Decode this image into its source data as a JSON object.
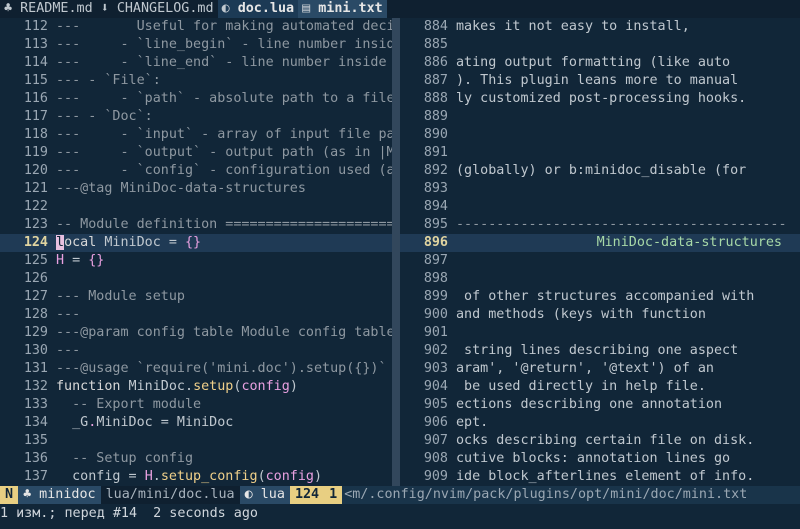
{
  "tabs": [
    {
      "icon": "file-icon",
      "glyph": "♣",
      "label": "README.md",
      "state": "normal"
    },
    {
      "icon": "markdown-icon",
      "glyph": "⬇",
      "label": "CHANGELOG.md",
      "state": "normal"
    },
    {
      "icon": "lua-icon",
      "glyph": "◐",
      "label": "doc.lua",
      "state": "active"
    },
    {
      "icon": "text-icon",
      "glyph": "▤",
      "label": "mini.txt",
      "state": "visible"
    }
  ],
  "left_pane": {
    "lines": [
      {
        "n": "112",
        "text": "---       Useful for making automated deci"
      },
      {
        "n": "113",
        "text": "---     - `line_begin` - line number insid"
      },
      {
        "n": "114",
        "text": "---     - `line_end` - line number inside"
      },
      {
        "n": "115",
        "text": "--- - `File`:"
      },
      {
        "n": "116",
        "text": "---     - `path` - absolute path to a file"
      },
      {
        "n": "117",
        "text": "--- - `Doc`:"
      },
      {
        "n": "118",
        "text": "---     - `input` - array of input file pa"
      },
      {
        "n": "119",
        "text": "---     - `output` - output path (as in |M"
      },
      {
        "n": "120",
        "text": "---     - `config` - configuration used (a"
      },
      {
        "n": "121",
        "text": "---@tag MiniDoc-data-structures"
      },
      {
        "n": "122",
        "text": ""
      },
      {
        "n": "123",
        "text": "-- Module definition ====================="
      },
      {
        "n": "124",
        "text": "local MiniDoc = {}"
      },
      {
        "n": "125",
        "text": "H = {}"
      },
      {
        "n": "126",
        "text": ""
      },
      {
        "n": "127",
        "text": "--- Module setup"
      },
      {
        "n": "128",
        "text": "---"
      },
      {
        "n": "129",
        "text": "---@param config table Module config table"
      },
      {
        "n": "130",
        "text": "---"
      },
      {
        "n": "131",
        "text": "---@usage `require('mini.doc').setup({})`"
      },
      {
        "n": "132",
        "text": "function MiniDoc.setup(config)"
      },
      {
        "n": "133",
        "text": "  -- Export module"
      },
      {
        "n": "134",
        "text": "  _G.MiniDoc = MiniDoc"
      },
      {
        "n": "135",
        "text": ""
      },
      {
        "n": "136",
        "text": "  -- Setup config"
      },
      {
        "n": "137",
        "text": "  config = H.setup_config(config)"
      }
    ],
    "current_line": "124"
  },
  "right_pane": {
    "lines": [
      {
        "n": "884",
        "text": "makes it not easy to install,"
      },
      {
        "n": "885",
        "text": ""
      },
      {
        "n": "886",
        "text": "ating output formatting (like auto"
      },
      {
        "n": "887",
        "text": "). This plugin leans more to manual"
      },
      {
        "n": "888",
        "text": "ly customized post-processing hooks."
      },
      {
        "n": "889",
        "text": ""
      },
      {
        "n": "890",
        "text": ""
      },
      {
        "n": "891",
        "text": ""
      },
      {
        "n": "892",
        "text": "(globally) or b:minidoc_disable (for"
      },
      {
        "n": "893",
        "text": ""
      },
      {
        "n": "894",
        "text": ""
      },
      {
        "n": "895",
        "text": "-----------------------------------------"
      },
      {
        "n": "896",
        "text": "MiniDoc-data-structures"
      },
      {
        "n": "897",
        "text": ""
      },
      {
        "n": "898",
        "text": ""
      },
      {
        "n": "899",
        "text": " of other structures accompanied with"
      },
      {
        "n": "900",
        "text": "and methods (keys with function"
      },
      {
        "n": "901",
        "text": ""
      },
      {
        "n": "902",
        "text": " string lines describing one aspect"
      },
      {
        "n": "903",
        "text": "aram', '@return', '@text') of an"
      },
      {
        "n": "904",
        "text": " be used directly in help file."
      },
      {
        "n": "905",
        "text": "ections describing one annotation"
      },
      {
        "n": "906",
        "text": "ept."
      },
      {
        "n": "907",
        "text": "ocks describing certain file on disk."
      },
      {
        "n": "908",
        "text": "cutive blocks: annotation lines go"
      },
      {
        "n": "909",
        "text": "ide block_afterlines element of info."
      }
    ],
    "current_line": "896"
  },
  "statusline": {
    "mode": "N",
    "branch": "♣ minidoc",
    "file": "lua/mini/doc.lua",
    "filetype": "◐ lua",
    "line": "124",
    "col": "1",
    "right_path": "<m/.config/nvim/pack/plugins/opt/mini/doc/mini.txt"
  },
  "cmdline": "1 изм.; перед #14  2 seconds ago",
  "colors": {
    "background": "#112638",
    "accent": "#e8cf82",
    "comment": "#8e98a1",
    "function": "#f0d08a"
  }
}
